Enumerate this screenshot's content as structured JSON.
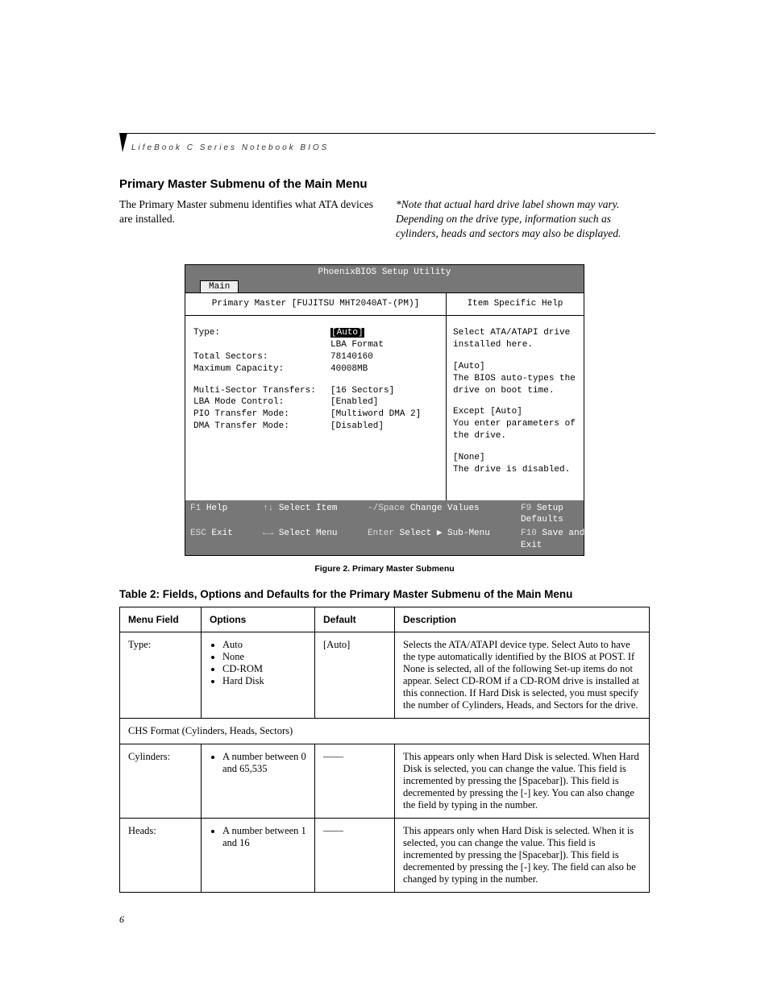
{
  "running_head": "LifeBook C Series Notebook BIOS",
  "section_title": "Primary Master Submenu of the Main Menu",
  "intro_left": "The Primary Master submenu identifies what ATA devices are installed.",
  "intro_right": "*Note that actual hard drive label shown may vary. Depending on the drive type, information such as cylinders, heads and sectors may also be displayed.",
  "bios": {
    "title": "PhoenixBIOS Setup Utility",
    "tab": "Main",
    "left_header": "Primary Master [FUJITSU MHT2040AT-(PM)]",
    "right_header": "Item Specific Help",
    "fields": {
      "type_label": "Type:",
      "type_value": "[Auto]",
      "lba_format": "LBA Format",
      "total_sectors_label": "Total Sectors:",
      "total_sectors_value": "78140160",
      "max_capacity_label": "Maximum Capacity:",
      "max_capacity_value": "40008MB",
      "multi_sector_label": "Multi-Sector Transfers:",
      "multi_sector_value": "[16 Sectors]",
      "lba_mode_label": "LBA Mode Control:",
      "lba_mode_value": "[Enabled]",
      "pio_label": "PIO Transfer Mode:",
      "pio_value": "[Multiword DMA 2]",
      "dma_label": "DMA Transfer Mode:",
      "dma_value": "[Disabled]"
    },
    "help": {
      "l1": "Select ATA/ATAPI drive installed here.",
      "l2": "[Auto]",
      "l3": "The BIOS auto-types the drive on boot time.",
      "l4": "Except [Auto]",
      "l5": "You enter parameters of the drive.",
      "l6": "[None]",
      "l7": "The drive is disabled."
    },
    "footer": {
      "f1_k": "F1",
      "f1_v": "Help",
      "ud_k": "↑↓",
      "ud_v": "Select Item",
      "sp_k": "-/Space",
      "sp_v": "Change Values",
      "f9_k": "F9",
      "f9_v": "Setup Defaults",
      "esc_k": "ESC",
      "esc_v": "Exit",
      "lr_k": "←→",
      "lr_v": "Select Menu",
      "en_k": "Enter",
      "en_v": "Select ▶ Sub-Menu",
      "f10_k": "F10",
      "f10_v": "Save and Exit"
    }
  },
  "figure_caption": "Figure 2.  Primary Master Submenu",
  "table_title": "Table 2: Fields, Options and Defaults for the Primary Master Submenu of the Main Menu",
  "table": {
    "headers": {
      "menu": "Menu Field",
      "options": "Options",
      "def": "Default",
      "desc": "Description"
    },
    "rows": [
      {
        "menu": "Type:",
        "options": [
          "Auto",
          "None",
          "CD-ROM",
          "Hard Disk"
        ],
        "def": "[Auto]",
        "desc": "Selects the ATA/ATAPI device type. Select Auto to have the type automatically identified by the BIOS at POST. If None is selected, all of the following Set-up items do not appear. Select CD-ROM if a CD-ROM drive is installed at this connection. If Hard Disk is selected, you must specify the number of Cylinders, Heads, and Sectors for the drive."
      },
      {
        "section": "CHS Format (Cylinders, Heads, Sectors)"
      },
      {
        "menu": "Cylinders:",
        "options": [
          "A number between 0 and 65,535"
        ],
        "def": "——",
        "desc": "This appears only when Hard Disk is selected. When Hard Disk is selected, you can change the value. This field is incremented by pressing the [Spacebar]). This field is decremented by pressing the [-] key. You can also change the field by typing in the number."
      },
      {
        "menu": "Heads:",
        "options": [
          "A number between 1 and 16"
        ],
        "def": "——",
        "desc": "This appears only when Hard Disk is selected. When it is selected, you can change the value. This field is incremented by pressing the [Spacebar]). This field is decremented by pressing the [-] key. The field can also be changed by typing in the number."
      }
    ]
  },
  "page_number": "6"
}
